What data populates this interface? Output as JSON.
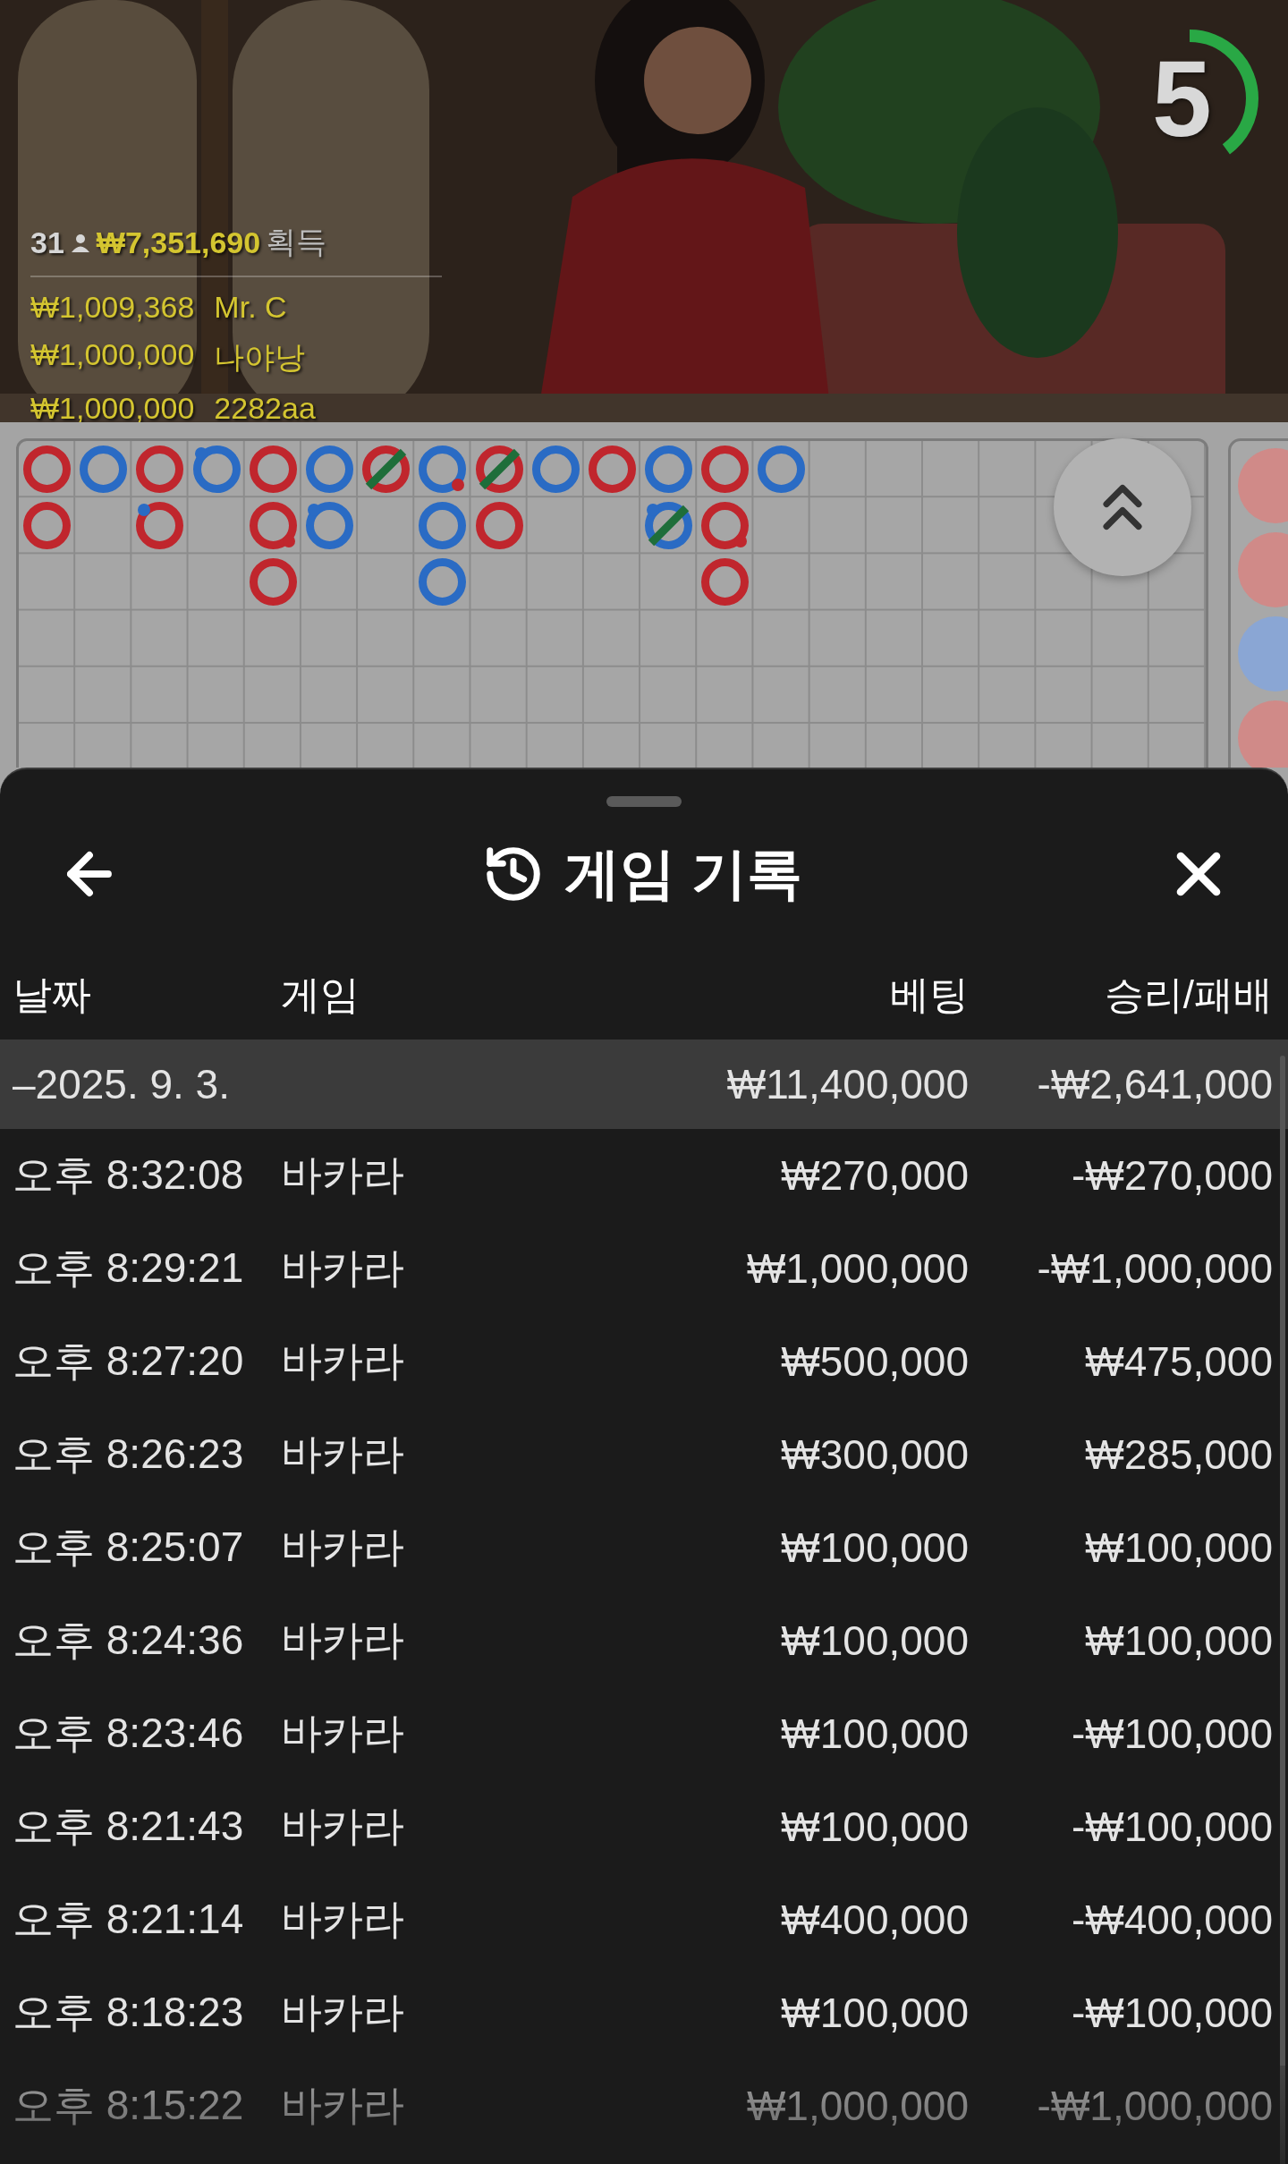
{
  "video": {
    "timer": {
      "text": "5",
      "level": 0.4
    },
    "total": {
      "count": "31",
      "amount": "₩7,351,690",
      "label": "획득"
    },
    "winners": [
      {
        "amount": "₩1,009,368",
        "name": "Mr. C"
      },
      {
        "amount": "₩1,000,000",
        "name": "나야낭"
      },
      {
        "amount": "₩1,000,000",
        "name": "2282aa"
      }
    ]
  },
  "road": {
    "columns": [
      [
        {
          "kind": "banker"
        },
        {
          "kind": "banker"
        }
      ],
      [
        {
          "kind": "player"
        }
      ],
      [
        {
          "kind": "banker"
        },
        {
          "kind": "banker",
          "player_pair": true
        }
      ],
      [
        {
          "kind": "player",
          "player_pair": true
        }
      ],
      [
        {
          "kind": "banker"
        },
        {
          "kind": "banker",
          "banker_pair": true
        },
        {
          "kind": "banker"
        }
      ],
      [
        {
          "kind": "player"
        },
        {
          "kind": "player",
          "player_pair": true
        }
      ],
      [
        {
          "kind": "banker",
          "tie": true
        }
      ],
      [
        {
          "kind": "player",
          "banker_pair": true
        },
        {
          "kind": "player"
        },
        {
          "kind": "player"
        }
      ],
      [
        {
          "kind": "banker",
          "tie": true
        },
        {
          "kind": "banker"
        }
      ],
      [
        {
          "kind": "player"
        }
      ],
      [
        {
          "kind": "banker"
        }
      ],
      [
        {
          "kind": "player"
        },
        {
          "kind": "player",
          "player_pair": true,
          "tie": true
        }
      ],
      [
        {
          "kind": "banker"
        },
        {
          "kind": "banker",
          "banker_pair": true
        },
        {
          "kind": "banker"
        }
      ],
      [
        {
          "kind": "player"
        }
      ]
    ]
  },
  "side_road": [
    {
      "kind": "banker"
    },
    {
      "kind": "banker"
    },
    {
      "kind": "player"
    },
    {
      "kind": "banker"
    }
  ],
  "sheet": {
    "title": "게임 기록",
    "columns": [
      "날짜",
      "게임",
      "베팅",
      "승리/패배"
    ],
    "group": {
      "date": "–2025. 9. 3.",
      "bet": "₩11,400,000",
      "result": "-₩2,641,000"
    },
    "rows": [
      {
        "time": "오후 8:32:08",
        "game": "바카라",
        "bet": "₩270,000",
        "result": "-₩270,000"
      },
      {
        "time": "오후 8:29:21",
        "game": "바카라",
        "bet": "₩1,000,000",
        "result": "-₩1,000,000"
      },
      {
        "time": "오후 8:27:20",
        "game": "바카라",
        "bet": "₩500,000",
        "result": "₩475,000"
      },
      {
        "time": "오후 8:26:23",
        "game": "바카라",
        "bet": "₩300,000",
        "result": "₩285,000"
      },
      {
        "time": "오후 8:25:07",
        "game": "바카라",
        "bet": "₩100,000",
        "result": "₩100,000"
      },
      {
        "time": "오후 8:24:36",
        "game": "바카라",
        "bet": "₩100,000",
        "result": "₩100,000"
      },
      {
        "time": "오후 8:23:46",
        "game": "바카라",
        "bet": "₩100,000",
        "result": "-₩100,000"
      },
      {
        "time": "오후 8:21:43",
        "game": "바카라",
        "bet": "₩100,000",
        "result": "-₩100,000"
      },
      {
        "time": "오후 8:21:14",
        "game": "바카라",
        "bet": "₩400,000",
        "result": "-₩400,000"
      },
      {
        "time": "오후 8:18:23",
        "game": "바카라",
        "bet": "₩100,000",
        "result": "-₩100,000"
      },
      {
        "time": "오후 8:15:22",
        "game": "바카라",
        "bet": "₩1,000,000",
        "result": "-₩1,000,000"
      }
    ]
  }
}
